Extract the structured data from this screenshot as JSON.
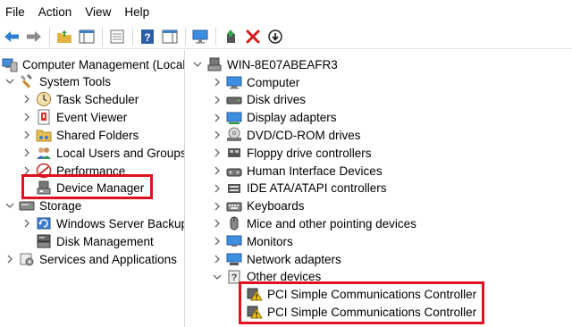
{
  "menubar": {
    "items": [
      "File",
      "Action",
      "View",
      "Help"
    ]
  },
  "tree": {
    "root": "Computer Management (Local",
    "system_tools": "System Tools",
    "task_scheduler": "Task Scheduler",
    "event_viewer": "Event Viewer",
    "shared_folders": "Shared Folders",
    "local_users": "Local Users and Groups",
    "performance": "Performance",
    "device_manager": "Device Manager",
    "storage": "Storage",
    "windows_server_backup": "Windows Server Backup",
    "disk_management": "Disk Management",
    "services_apps": "Services and Applications"
  },
  "devices": {
    "host": "WIN-8E07ABEAFR3",
    "categories": [
      "Computer",
      "Disk drives",
      "Display adapters",
      "DVD/CD-ROM drives",
      "Floppy drive controllers",
      "Human Interface Devices",
      "IDE ATA/ATAPI controllers",
      "Keyboards",
      "Mice and other pointing devices",
      "Monitors",
      "Network adapters",
      "Other devices"
    ],
    "other_devices": [
      "PCI Simple Communications Controller",
      "PCI Simple Communications Controller"
    ]
  },
  "colors": {
    "highlight": "#e01020",
    "chevron": "#666666",
    "accent": "#1a6fc2"
  }
}
